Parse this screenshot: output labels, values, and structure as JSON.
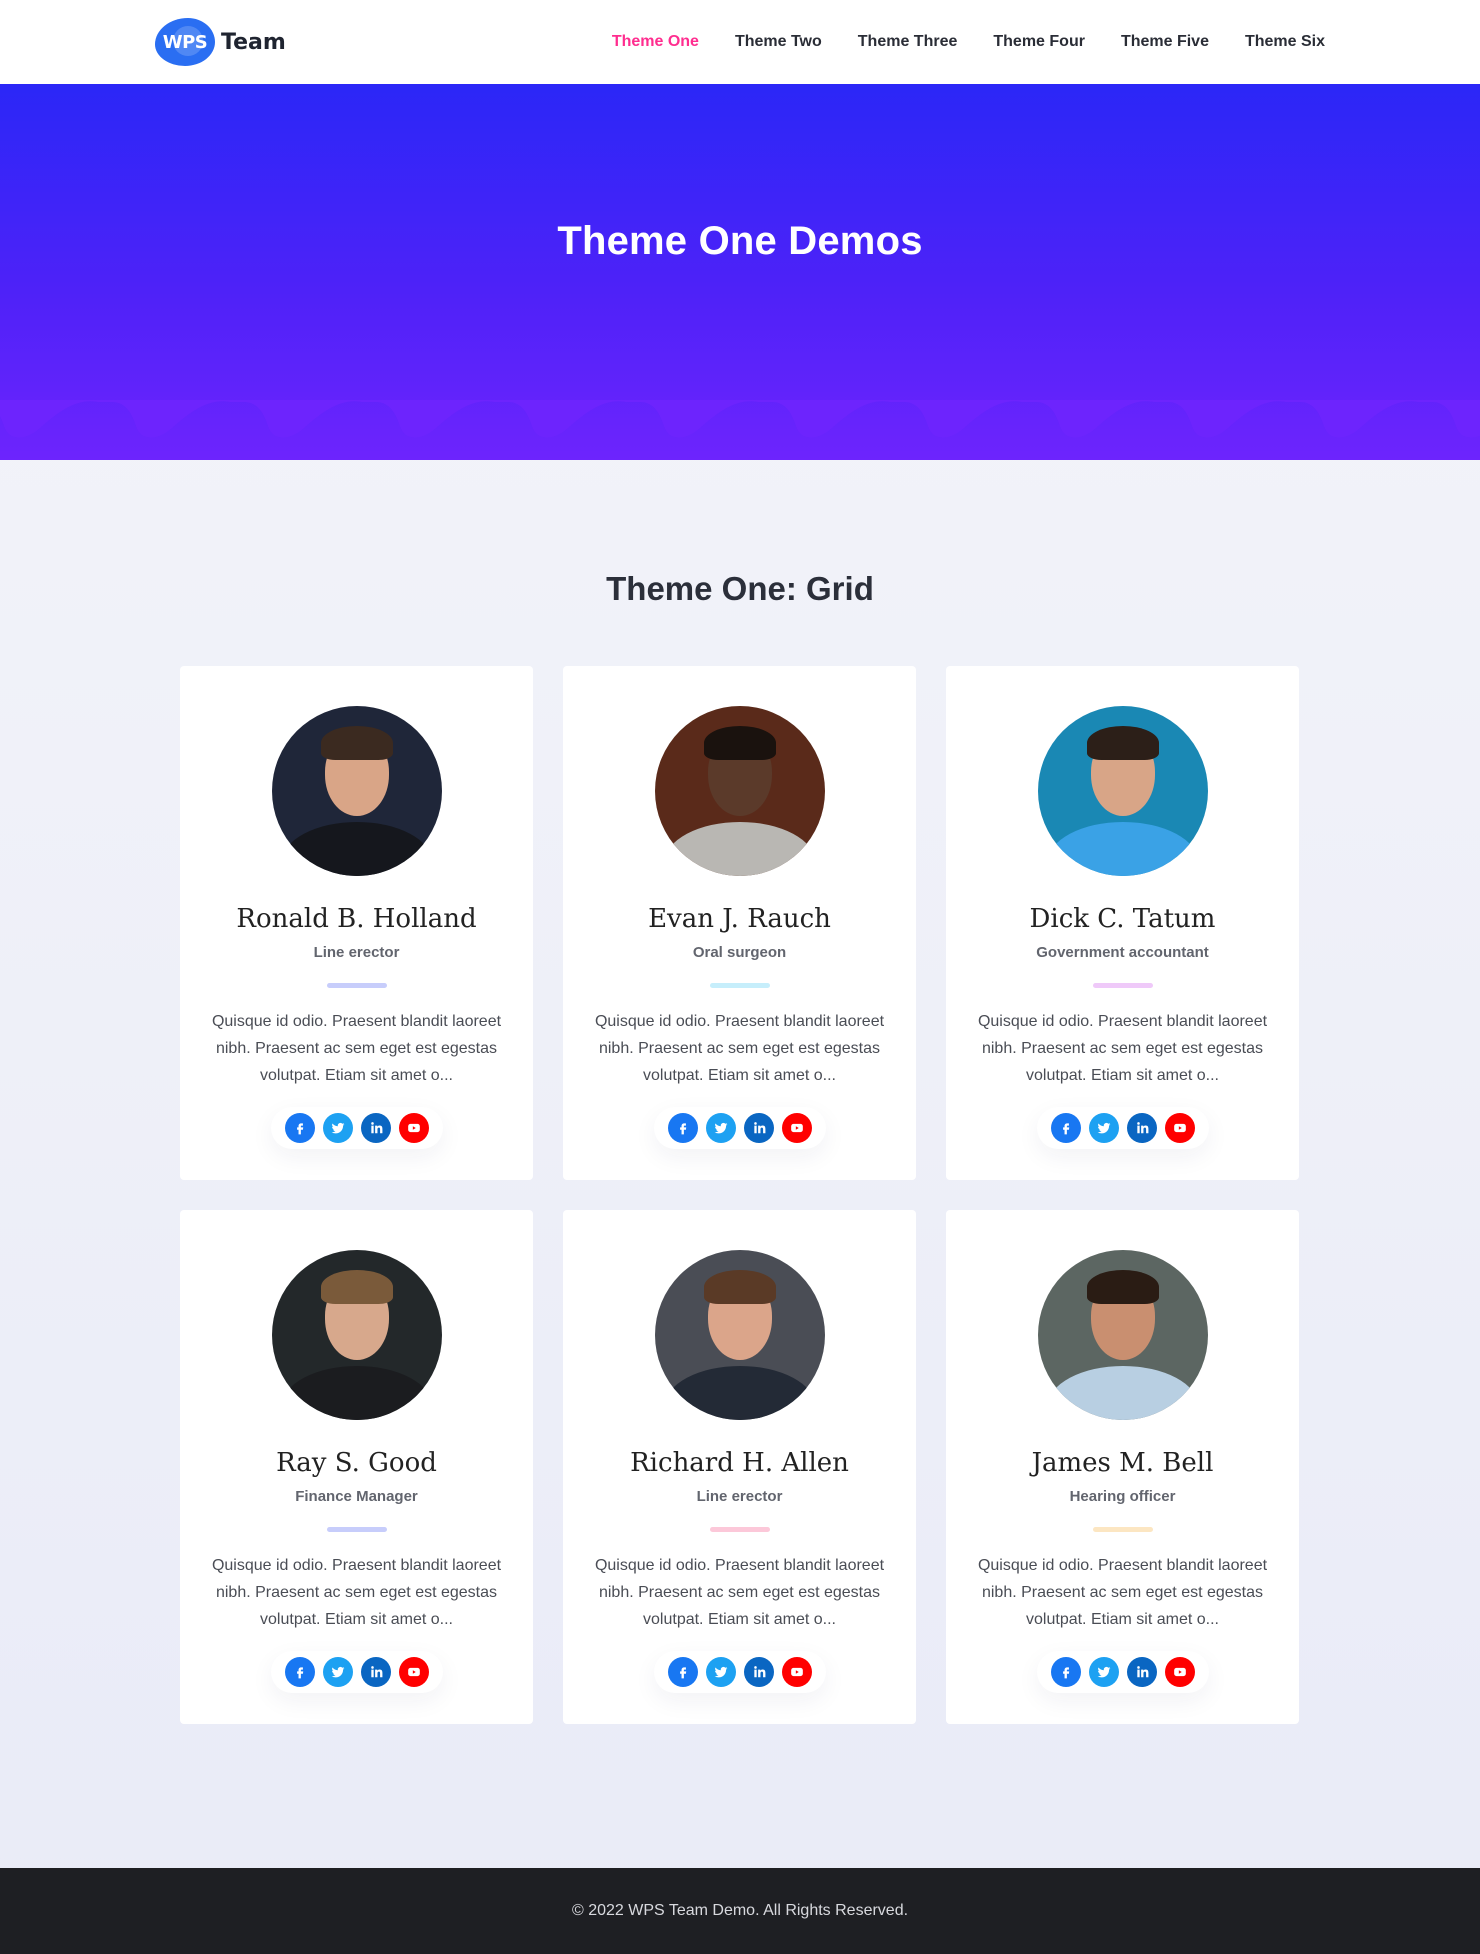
{
  "header": {
    "logo_badge": "WPS",
    "logo_text": "Team",
    "nav": [
      {
        "label": "Theme One",
        "active": true
      },
      {
        "label": "Theme Two",
        "active": false
      },
      {
        "label": "Theme Three",
        "active": false
      },
      {
        "label": "Theme Four",
        "active": false
      },
      {
        "label": "Theme Five",
        "active": false
      },
      {
        "label": "Theme Six",
        "active": false
      }
    ]
  },
  "hero": {
    "title": "Theme One Demos"
  },
  "section": {
    "title": "Theme One: Grid"
  },
  "social_icons": [
    {
      "name": "facebook-icon",
      "color": "#1877f2"
    },
    {
      "name": "twitter-icon",
      "color": "#1da1f2"
    },
    {
      "name": "linkedin-icon",
      "color": "#0a66c2"
    },
    {
      "name": "youtube-icon",
      "color": "#ff0000"
    }
  ],
  "members": [
    {
      "name": "Ronald B. Holland",
      "role": "Line erector",
      "accent": "#c7cdfb",
      "bio": "Quisque id odio. Praesent blandit laoreet nibh. Praesent ac sem eget est egestas volutpat. Etiam sit amet o...",
      "photo": {
        "bg": "#1f2639",
        "skin": "#d9a587",
        "hair": "#3b2a20",
        "cloth": "#15171d"
      }
    },
    {
      "name": "Evan J. Rauch",
      "role": "Oral surgeon",
      "accent": "#c6eefb",
      "bio": "Quisque id odio. Praesent blandit laoreet nibh. Praesent ac sem eget est egestas volutpat. Etiam sit amet o...",
      "photo": {
        "bg": "#5a2a1a",
        "skin": "#5b3a2a",
        "hair": "#1a120e",
        "cloth": "#b9b7b3"
      }
    },
    {
      "name": "Dick C. Tatum",
      "role": "Government accountant",
      "accent": "#efc9f9",
      "bio": "Quisque id odio. Praesent blandit laoreet nibh. Praesent ac sem eget est egestas volutpat. Etiam sit amet o...",
      "photo": {
        "bg": "#1a88b4",
        "skin": "#d8a587",
        "hair": "#2c1f18",
        "cloth": "#3aa2e6"
      }
    },
    {
      "name": "Ray S. Good",
      "role": "Finance Manager",
      "accent": "#c7cdfb",
      "bio": "Quisque id odio. Praesent blandit laoreet nibh. Praesent ac sem eget est egestas volutpat. Etiam sit amet o...",
      "photo": {
        "bg": "#23282a",
        "skin": "#d7a88c",
        "hair": "#7a5a3a",
        "cloth": "#1b1c1f"
      }
    },
    {
      "name": "Richard H. Allen",
      "role": "Line erector",
      "accent": "#fcc8d9",
      "bio": "Quisque id odio. Praesent blandit laoreet nibh. Praesent ac sem eget est egestas volutpat. Etiam sit amet o...",
      "photo": {
        "bg": "#4a4d55",
        "skin": "#dba58a",
        "hair": "#5a3a26",
        "cloth": "#232a36"
      }
    },
    {
      "name": "James M. Bell",
      "role": "Hearing officer",
      "accent": "#fce6c2",
      "bio": "Quisque id odio. Praesent blandit laoreet nibh. Praesent ac sem eget est egestas volutpat. Etiam sit amet o...",
      "photo": {
        "bg": "#5c6662",
        "skin": "#c98f70",
        "hair": "#2a1c14",
        "cloth": "#b8cfe2"
      }
    }
  ],
  "footer": {
    "text": "© 2022 WPS Team Demo. All Rights Reserved."
  }
}
